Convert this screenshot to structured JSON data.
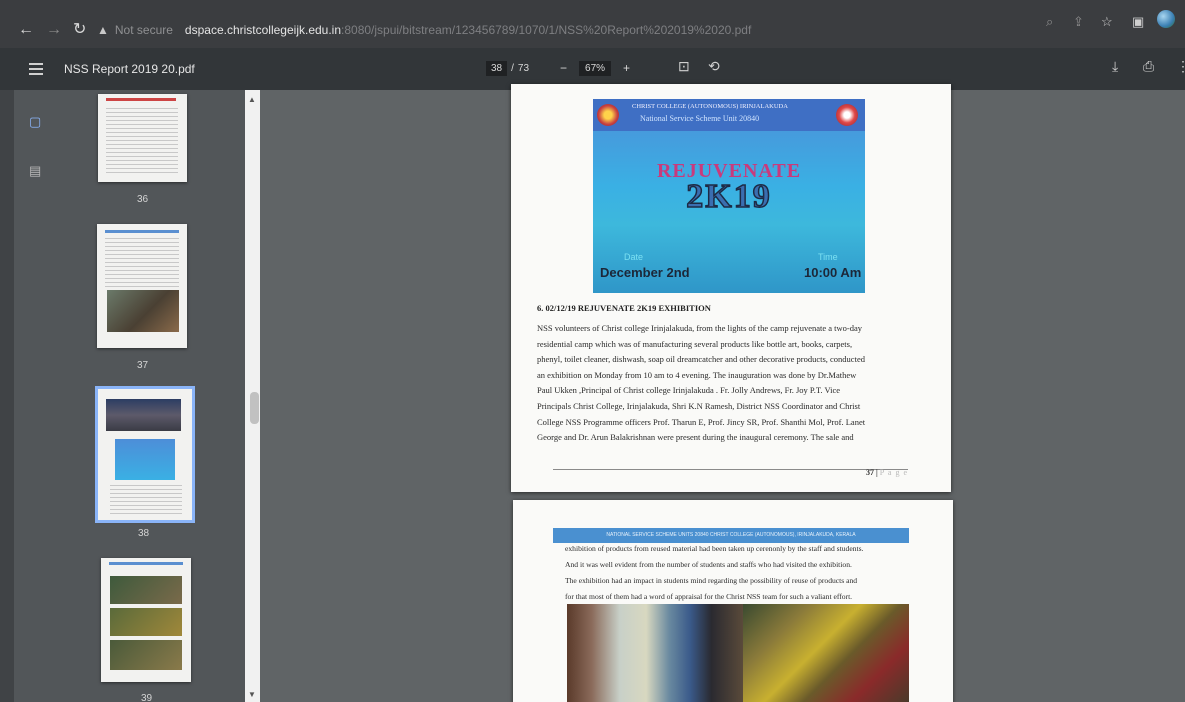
{
  "browser": {
    "url_warning": "Not secure",
    "url_host": "dspace.christcollegeijk.edu.in",
    "url_path": ":8080/jspui/bitstream/123456789/1070/1/NSS%20Report%202019%2020.pdf"
  },
  "pdf_toolbar": {
    "title": "NSS Report 2019 20.pdf",
    "current_page": "38",
    "page_separator": "/",
    "total_pages": "73",
    "zoom": "67%",
    "zoom_out": "−",
    "zoom_in": "+"
  },
  "thumbnails": [
    {
      "label": "36"
    },
    {
      "label": "37"
    },
    {
      "label": "38"
    },
    {
      "label": "39"
    }
  ],
  "page37": {
    "banner": {
      "org_line": "CHRIST COLLEGE (AUTONOMOUS) IRINJALAKUDA",
      "unit_line": "National Service Scheme Unit 20840",
      "event_name": "REJUVENATE",
      "event_year": "2K19",
      "date_label": "Date",
      "date_value": "December 2nd",
      "time_label": "Time",
      "time_value": "10:00 Am"
    },
    "section_heading": "6.  02/12/19 REJUVENATE 2K19 EXHIBITION",
    "body_lines": [
      "NSS volunteers of Christ college Irinjalakuda, from the lights of the camp rejuvenate a two-day",
      "residential camp which was of manufacturing several products like bottle art, books, carpets,",
      "phenyl, toilet cleaner, dishwash, soap oil dreamcatcher and other decorative products, conducted",
      "an exhibition on Monday from 10 am to 4 evening. The inauguration was done by Dr.Mathew",
      "Paul Ukken ,Principal of Christ college Irinjalakuda . Fr. Jolly Andrews, Fr. Joy P.T. Vice",
      "Principals Christ College, Irinjalakuda, Shri K.N Ramesh, District NSS Coordinator and Christ",
      "College NSS Programme officers Prof. Tharun E, Prof. Jincy SR, Prof. Shanthi Mol, Prof. Lanet",
      "George and Dr. Arun Balakrishnan were present during the inaugural ceremony. The sale and"
    ],
    "page_number": "37",
    "page_word": "P a g e"
  },
  "page38": {
    "header": "NATIONAL SERVICE SCHEME UNITS 20840 CHRIST COLLEGE (AUTONOMOUS), IRINJALAKUDA, KERALA",
    "body_lines": [
      "exhibition of products from reused material had been taken up cerenonly by the staff and students.",
      "And it was well evident from the number of students and staffs who had visited the exhibition.",
      "The exhibition had an impact in students mind regarding the possibility of reuse of products and",
      "for that most of them had a word of appraisal for the Christ NSS team for such a valiant effort."
    ]
  }
}
